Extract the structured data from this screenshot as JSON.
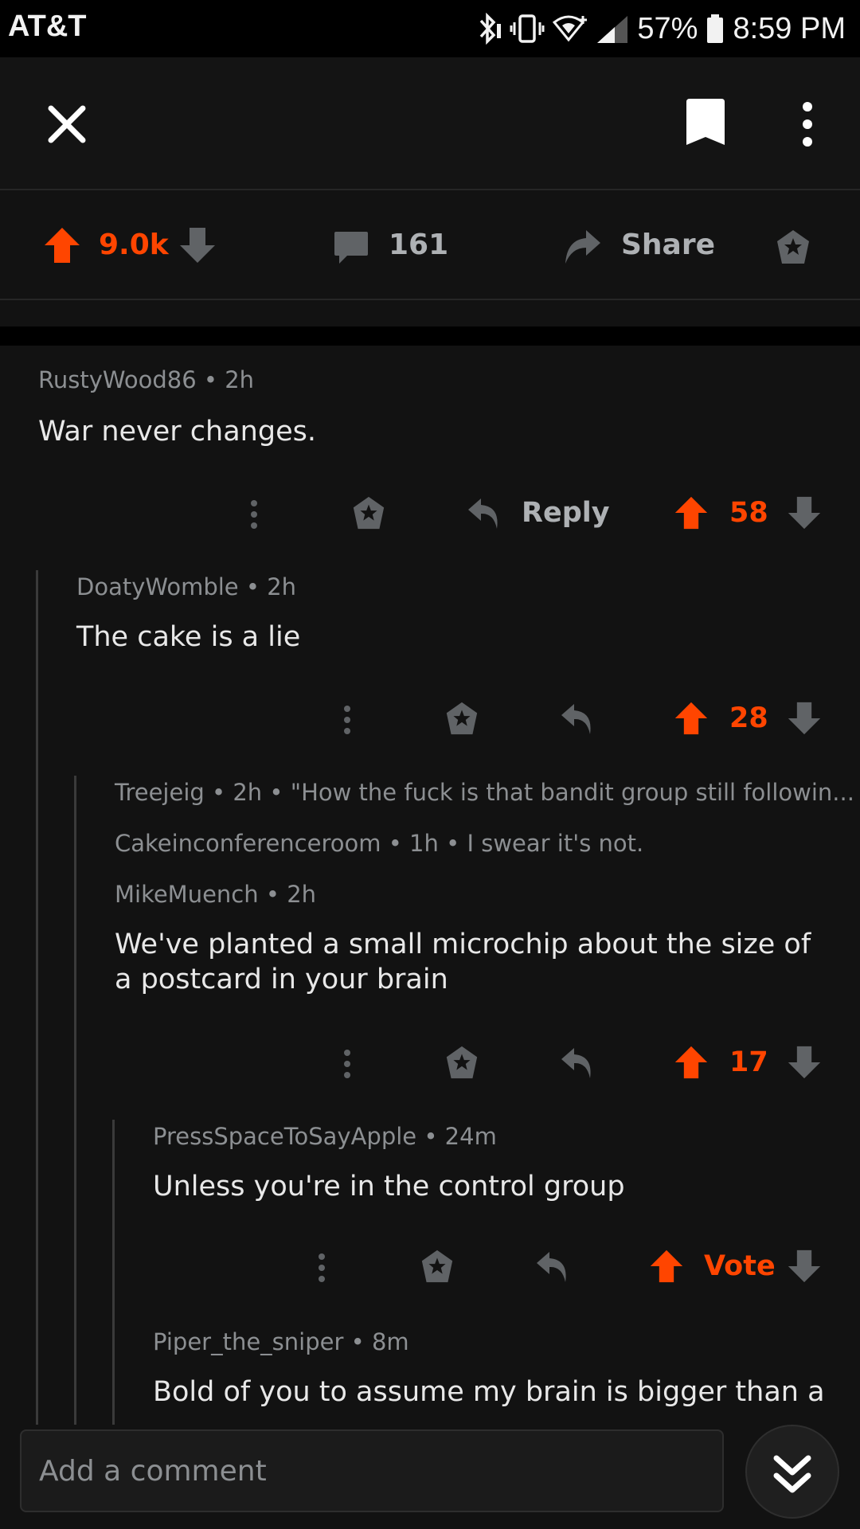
{
  "status_bar": {
    "carrier": "AT&T",
    "battery_pct": "57%",
    "time": "8:59 PM"
  },
  "post_actions": {
    "score": "9.0k",
    "comment_count": "161",
    "share_label": "Share"
  },
  "comments": [
    {
      "author": "RustyWood86",
      "age": "2h",
      "body": "War never changes.",
      "score": "58",
      "reply_label": "Reply"
    },
    {
      "author": "DoatyWomble",
      "age": "2h",
      "body": "The cake is a lie",
      "score": "28"
    },
    {
      "collapsed": true,
      "author": "Treejeig",
      "age": "2h",
      "preview": "\"How the fuck is that bandit group still followin..."
    },
    {
      "collapsed": true,
      "author": "Cakeinconferenceroom",
      "age": "1h",
      "preview": "I swear it's not."
    },
    {
      "author": "MikeMuench",
      "age": "2h",
      "body": "We've planted a small microchip about the size of a postcard in your brain",
      "score": "17"
    },
    {
      "author": "PressSpaceToSayApple",
      "age": "24m",
      "body": "Unless you're in the control group",
      "score": "Vote"
    },
    {
      "author": "Piper_the_sniper",
      "age": "8m",
      "body": "Bold of you to assume my brain is bigger than a"
    }
  ],
  "comment_input": {
    "placeholder": "Add a comment"
  },
  "colors": {
    "upvote": "#ff4500",
    "background": "#121212",
    "muted": "#8c8f92"
  }
}
